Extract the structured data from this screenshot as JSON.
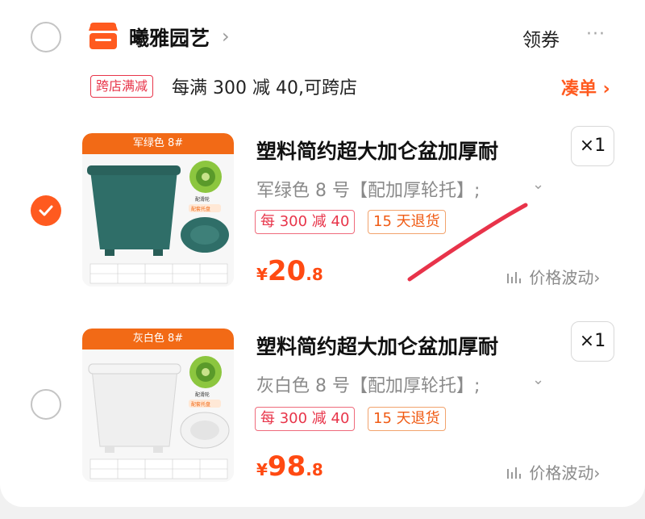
{
  "shop": {
    "name": "曦雅园艺",
    "chevron": "›",
    "coupon_label": "领券",
    "more_label": "···"
  },
  "promo": {
    "tag": "跨店满减",
    "text": "每满 300 减 40,可跨店",
    "addon_label": "凑单 ›"
  },
  "items": [
    {
      "checked": true,
      "thumb_label": "军绿色 8#",
      "pot_color": "#2f6e68",
      "title": "塑料简约超大加仑盆加厚耐",
      "quantity": "×1",
      "spec": "军绿色 8 号【配加厚轮托】;",
      "spec_chevron": "⌄",
      "tags": [
        "每 300 减 40",
        "15 天退货"
      ],
      "price": {
        "currency": "¥",
        "integer": "20",
        "decimal": ".8"
      },
      "trend_label": "价格波动"
    },
    {
      "checked": false,
      "thumb_label": "灰白色 8#",
      "pot_color": "#efefef",
      "title": "塑料简约超大加仑盆加厚耐",
      "quantity": "×1",
      "spec": "灰白色 8 号【配加厚轮托】;",
      "spec_chevron": "⌄",
      "tags": [
        "每 300 减 40",
        "15 天退货"
      ],
      "price": {
        "currency": "¥",
        "integer": "98",
        "decimal": ".8"
      },
      "trend_label": "价格波动"
    }
  ],
  "colors": {
    "accent": "#ff5a1f",
    "price": "#ff4a12",
    "promo_red": "#e8354a",
    "scribble": "#e8334a"
  }
}
